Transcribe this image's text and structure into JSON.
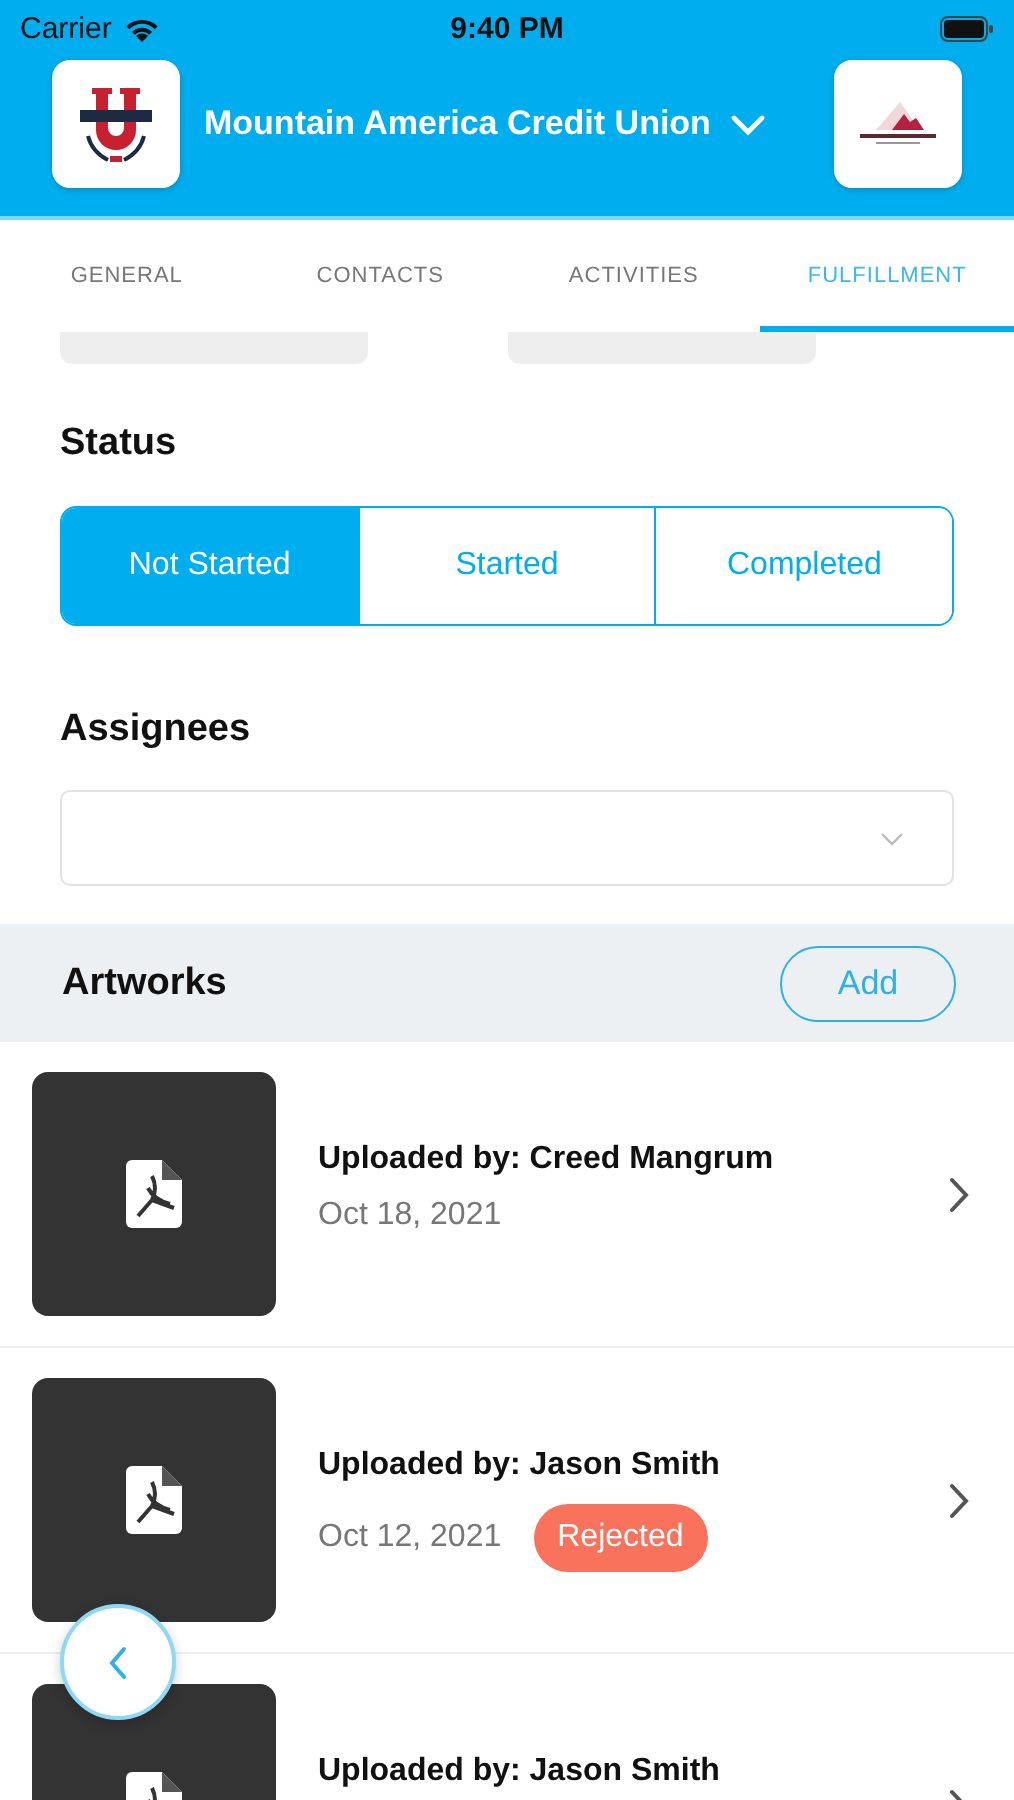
{
  "status_bar": {
    "carrier": "Carrier",
    "time": "9:40 PM"
  },
  "header": {
    "title": "Mountain America Credit Union"
  },
  "tabs": [
    {
      "label": "GENERAL",
      "selected": false
    },
    {
      "label": "CONTACTS",
      "selected": false
    },
    {
      "label": "ACTIVITIES",
      "selected": false
    },
    {
      "label": "FULFILLMENT",
      "selected": true
    }
  ],
  "status": {
    "label": "Status",
    "options": [
      {
        "label": "Not Started",
        "selected": true
      },
      {
        "label": "Started",
        "selected": false
      },
      {
        "label": "Completed",
        "selected": false
      }
    ]
  },
  "assignees": {
    "label": "Assignees"
  },
  "artworks": {
    "title": "Artworks",
    "add_button": "Add",
    "items": [
      {
        "uploaded_by": "Uploaded by: Creed Mangrum",
        "date": "Oct 18, 2021"
      },
      {
        "uploaded_by": "Uploaded by: Jason Smith",
        "date": "Oct 12, 2021",
        "badge": {
          "label": "Rejected",
          "color": "#f9735c"
        }
      },
      {
        "uploaded_by": "Uploaded by: Jason Smith"
      }
    ]
  }
}
